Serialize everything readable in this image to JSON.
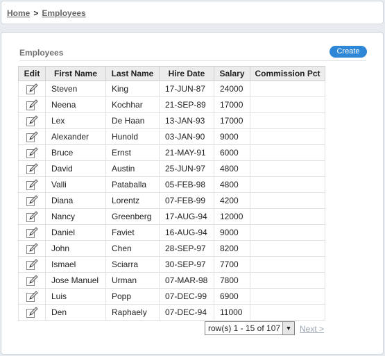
{
  "breadcrumb": {
    "home": "Home",
    "separator": ">",
    "current": "Employees"
  },
  "region": {
    "title": "Employees",
    "create_label": "Create"
  },
  "table": {
    "headers": [
      "Edit",
      "First Name",
      "Last Name",
      "Hire Date",
      "Salary",
      "Commission Pct"
    ],
    "rows": [
      {
        "first": "Steven",
        "last": "King",
        "hire": "17-JUN-87",
        "salary": "24000",
        "commission": ""
      },
      {
        "first": "Neena",
        "last": "Kochhar",
        "hire": "21-SEP-89",
        "salary": "17000",
        "commission": ""
      },
      {
        "first": "Lex",
        "last": "De Haan",
        "hire": "13-JAN-93",
        "salary": "17000",
        "commission": ""
      },
      {
        "first": "Alexander",
        "last": "Hunold",
        "hire": "03-JAN-90",
        "salary": "9000",
        "commission": ""
      },
      {
        "first": "Bruce",
        "last": "Ernst",
        "hire": "21-MAY-91",
        "salary": "6000",
        "commission": ""
      },
      {
        "first": "David",
        "last": "Austin",
        "hire": "25-JUN-97",
        "salary": "4800",
        "commission": ""
      },
      {
        "first": "Valli",
        "last": "Pataballa",
        "hire": "05-FEB-98",
        "salary": "4800",
        "commission": ""
      },
      {
        "first": "Diana",
        "last": "Lorentz",
        "hire": "07-FEB-99",
        "salary": "4200",
        "commission": ""
      },
      {
        "first": "Nancy",
        "last": "Greenberg",
        "hire": "17-AUG-94",
        "salary": "12000",
        "commission": ""
      },
      {
        "first": "Daniel",
        "last": "Faviet",
        "hire": "16-AUG-94",
        "salary": "9000",
        "commission": ""
      },
      {
        "first": "John",
        "last": "Chen",
        "hire": "28-SEP-97",
        "salary": "8200",
        "commission": ""
      },
      {
        "first": "Ismael",
        "last": "Sciarra",
        "hire": "30-SEP-97",
        "salary": "7700",
        "commission": ""
      },
      {
        "first": "Jose Manuel",
        "last": "Urman",
        "hire": "07-MAR-98",
        "salary": "7800",
        "commission": ""
      },
      {
        "first": "Luis",
        "last": "Popp",
        "hire": "07-DEC-99",
        "salary": "6900",
        "commission": ""
      },
      {
        "first": "Den",
        "last": "Raphaely",
        "hire": "07-DEC-94",
        "salary": "11000",
        "commission": ""
      }
    ]
  },
  "pagination": {
    "range_label": "row(s) 1 - 15 of 107",
    "next_label": "Next >"
  },
  "icons": {
    "edit": "pencil-edit-icon",
    "dropdown": "chevron-down-icon"
  },
  "colors": {
    "accent": "#2d86d6",
    "link_disabled": "#9aa4b0",
    "header_bg": "#ececec"
  }
}
